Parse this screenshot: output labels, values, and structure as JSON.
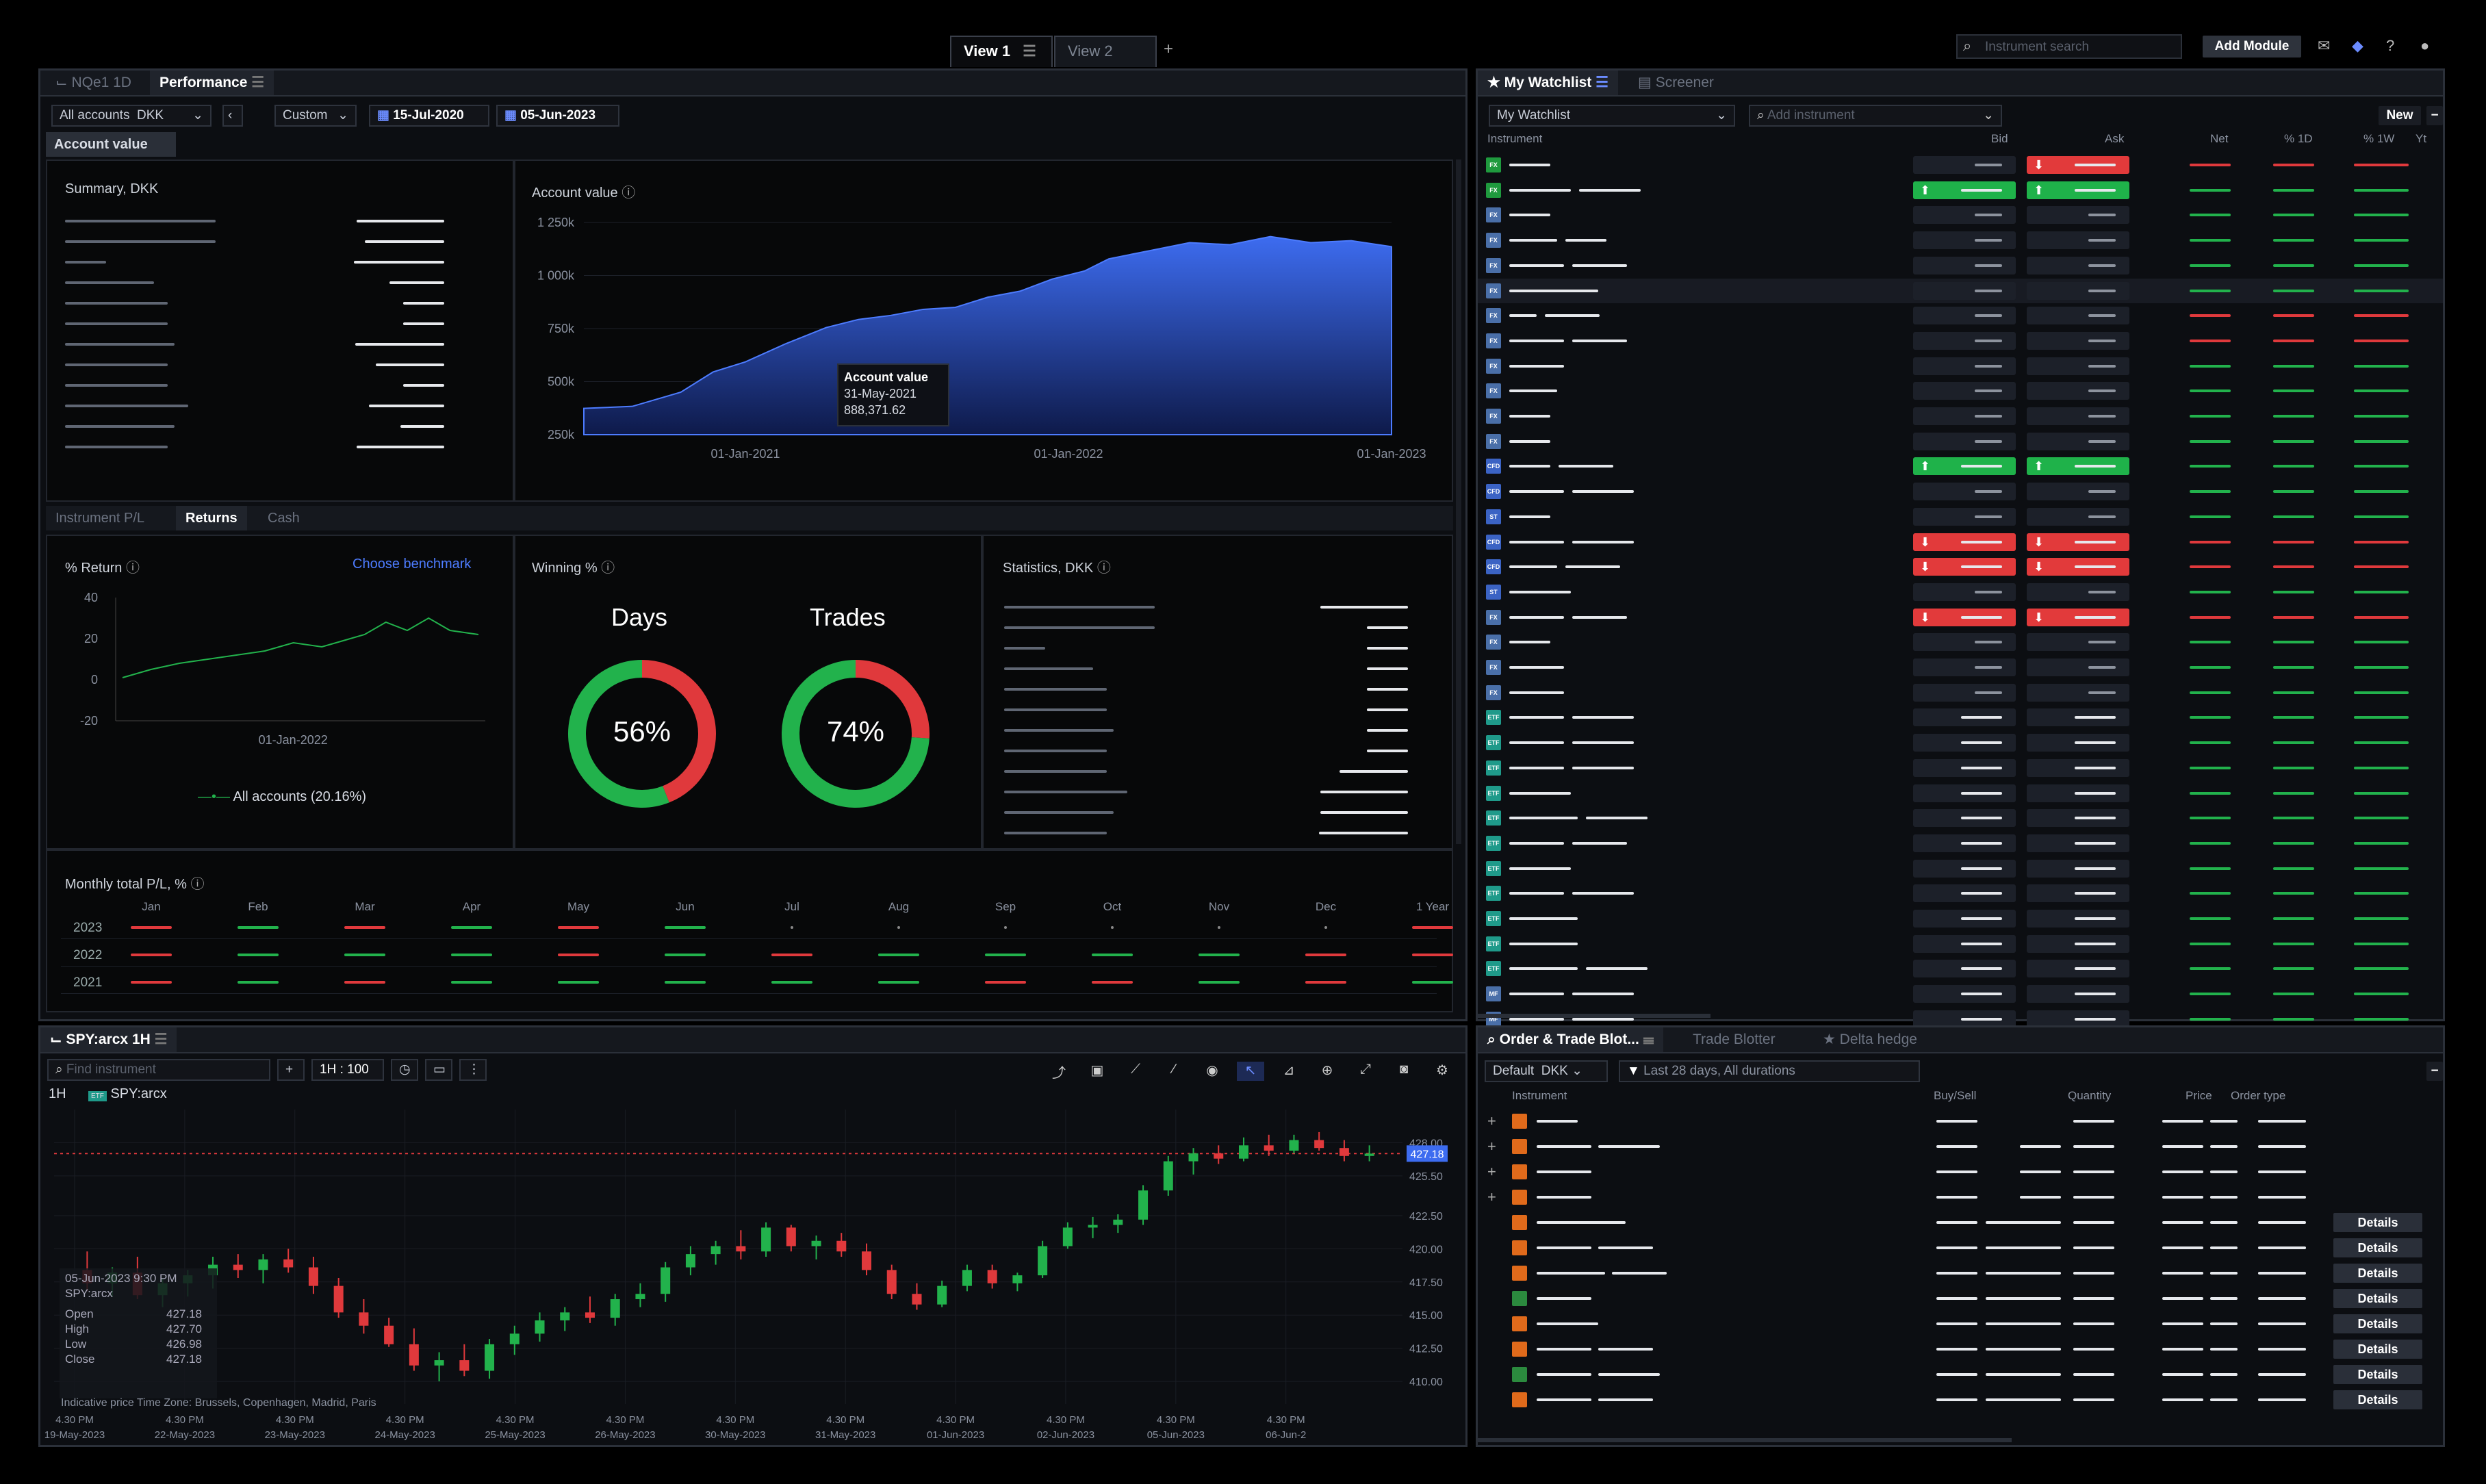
{
  "topbar": {
    "tabs": [
      {
        "label": "View 1"
      },
      {
        "label": "View 2"
      }
    ],
    "add_tab": "+",
    "search_placeholder": "Instrument search",
    "add_module": "Add Module"
  },
  "performance": {
    "tabs": [
      "NQe1 1D",
      "Performance"
    ],
    "account": "All accounts",
    "currency": "DKK",
    "period": "Custom",
    "from_date": "15-Jul-2020",
    "to_date": "05-Jun-2023",
    "section_tab": "Account value",
    "summary_title": "Summary, DKK",
    "chart_title": "Account value",
    "tooltip": {
      "title": "Account value",
      "date": "31-May-2021",
      "value": "888,371.62"
    },
    "sub_tabs": [
      "Instrument P/L",
      "Returns",
      "Cash"
    ],
    "return_title": "% Return",
    "benchmark": "Choose benchmark",
    "return_legend": "All accounts (20.16%)",
    "winning_title": "Winning %",
    "days_label": "Days",
    "days_value": "56%",
    "trades_label": "Trades",
    "trades_value": "74%",
    "stats_title": "Statistics, DKK",
    "monthly_title": "Monthly total P/L, %",
    "months": [
      "Jan",
      "Feb",
      "Mar",
      "Apr",
      "May",
      "Jun",
      "Jul",
      "Aug",
      "Sep",
      "Oct",
      "Nov",
      "Dec",
      "1 Year"
    ],
    "years": [
      "2023",
      "2022",
      "2021"
    ],
    "monthly_colors": [
      [
        "r",
        "g",
        "r",
        "g",
        "r",
        "g",
        "d",
        "d",
        "d",
        "d",
        "d",
        "d",
        "r"
      ],
      [
        "r",
        "g",
        "g",
        "g",
        "r",
        "g",
        "r",
        "g",
        "g",
        "g",
        "g",
        "r",
        "r"
      ],
      [
        "r",
        "g",
        "r",
        "g",
        "g",
        "g",
        "g",
        "g",
        "r",
        "r",
        "g",
        "r",
        "g"
      ]
    ]
  },
  "chart_data": [
    {
      "type": "area",
      "title": "Account value",
      "x_ticks": [
        "01-Jan-2021",
        "01-Jan-2022",
        "01-Jan-2023"
      ],
      "y_ticks": [
        "1 250k",
        "1 000k",
        "750k",
        "500k",
        "250k"
      ],
      "ylim": [
        250000,
        1300000
      ],
      "x": [
        0,
        0.06,
        0.12,
        0.16,
        0.2,
        0.25,
        0.3,
        0.34,
        0.38,
        0.42,
        0.46,
        0.5,
        0.54,
        0.58,
        0.62,
        0.65,
        0.7,
        0.75,
        0.8,
        0.85,
        0.9,
        0.95,
        1.0
      ],
      "values": [
        380000,
        390000,
        460000,
        560000,
        610000,
        700000,
        780000,
        820000,
        840000,
        870000,
        880000,
        930000,
        960000,
        1020000,
        1060000,
        1120000,
        1160000,
        1200000,
        1190000,
        1230000,
        1200000,
        1210000,
        1180000
      ],
      "color": "#3d6cf0"
    },
    {
      "type": "line",
      "title": "% Return",
      "y_ticks": [
        "40",
        "20",
        "0",
        "-20"
      ],
      "x_ticks": [
        "01-Jan-2022"
      ],
      "ylim": [
        -20,
        40
      ],
      "x": [
        0,
        0.08,
        0.16,
        0.24,
        0.32,
        0.4,
        0.48,
        0.56,
        0.62,
        0.68,
        0.74,
        0.8,
        0.86,
        0.92,
        1.0
      ],
      "values": [
        1,
        5,
        8,
        10,
        12,
        14,
        18,
        16,
        19,
        22,
        28,
        24,
        30,
        24,
        22
      ],
      "series": [
        {
          "name": "All accounts (20.16%)"
        }
      ],
      "color": "#22b24c"
    },
    {
      "type": "pie",
      "title": "Days",
      "slices": [
        {
          "label": "win",
          "value": 56,
          "color": "#22b24c"
        },
        {
          "label": "loss",
          "value": 44,
          "color": "#e0393c"
        }
      ]
    },
    {
      "type": "pie",
      "title": "Trades",
      "slices": [
        {
          "label": "win",
          "value": 74,
          "color": "#22b24c"
        },
        {
          "label": "loss",
          "value": 26,
          "color": "#e0393c"
        }
      ]
    },
    {
      "type": "bar",
      "title": "SPY:arcx 1H",
      "ylim": [
        408.3,
        430.5
      ],
      "y_ticks": [
        "428.00",
        "425.50",
        "422.50",
        "420.00",
        "417.50",
        "415.00",
        "412.50",
        "410.00"
      ],
      "current_price": "427.18",
      "candles": [
        [
          418.4,
          419.8,
          416.8,
          417.4
        ],
        [
          417.4,
          418.6,
          416.4,
          418.2
        ],
        [
          418.2,
          419.4,
          416.2,
          416.5
        ],
        [
          416.5,
          417.8,
          415.6,
          417.4
        ],
        [
          417.4,
          418.4,
          416.4,
          418.0
        ],
        [
          418.0,
          419.4,
          417.0,
          418.8
        ],
        [
          418.8,
          419.6,
          417.8,
          418.4
        ],
        [
          418.4,
          419.6,
          417.4,
          419.2
        ],
        [
          419.2,
          420.0,
          418.2,
          418.6
        ],
        [
          418.6,
          419.4,
          416.6,
          417.2
        ],
        [
          417.2,
          417.8,
          414.8,
          415.2
        ],
        [
          415.2,
          416.2,
          413.6,
          414.2
        ],
        [
          414.2,
          414.8,
          412.6,
          412.8
        ],
        [
          412.8,
          414.0,
          410.8,
          411.2
        ],
        [
          411.2,
          412.2,
          410.0,
          411.6
        ],
        [
          411.6,
          412.8,
          410.4,
          410.8
        ],
        [
          410.8,
          413.2,
          410.2,
          412.8
        ],
        [
          412.8,
          414.2,
          412.0,
          413.6
        ],
        [
          413.6,
          415.2,
          413.0,
          414.6
        ],
        [
          414.6,
          415.6,
          413.8,
          415.2
        ],
        [
          415.2,
          416.4,
          414.4,
          414.8
        ],
        [
          414.8,
          416.6,
          414.2,
          416.2
        ],
        [
          416.2,
          417.4,
          415.6,
          416.6
        ],
        [
          416.6,
          419.0,
          416.0,
          418.6
        ],
        [
          418.6,
          420.2,
          418.0,
          419.6
        ],
        [
          419.6,
          420.6,
          418.8,
          420.2
        ],
        [
          420.2,
          421.4,
          419.2,
          419.8
        ],
        [
          419.8,
          422.0,
          419.4,
          421.6
        ],
        [
          421.6,
          421.8,
          419.8,
          420.2
        ],
        [
          420.2,
          421.0,
          419.2,
          420.6
        ],
        [
          420.6,
          421.2,
          419.4,
          419.8
        ],
        [
          419.8,
          420.4,
          418.0,
          418.4
        ],
        [
          418.4,
          418.8,
          416.2,
          416.6
        ],
        [
          416.6,
          417.4,
          415.4,
          415.8
        ],
        [
          415.8,
          417.6,
          415.6,
          417.2
        ],
        [
          417.2,
          418.8,
          416.8,
          418.4
        ],
        [
          418.4,
          418.8,
          417.0,
          417.4
        ],
        [
          417.4,
          418.2,
          416.8,
          418.0
        ],
        [
          418.0,
          420.6,
          417.8,
          420.2
        ],
        [
          420.2,
          422.0,
          420.0,
          421.6
        ],
        [
          421.6,
          422.4,
          420.8,
          421.8
        ],
        [
          421.8,
          422.6,
          421.2,
          422.2
        ],
        [
          422.2,
          424.8,
          421.8,
          424.4
        ],
        [
          424.4,
          427.0,
          424.0,
          426.6
        ],
        [
          426.6,
          427.6,
          425.6,
          427.2
        ],
        [
          427.2,
          427.8,
          426.4,
          426.8
        ],
        [
          426.8,
          428.4,
          426.6,
          427.8
        ],
        [
          427.8,
          428.6,
          427.0,
          427.4
        ],
        [
          427.4,
          428.6,
          427.2,
          428.2
        ],
        [
          428.2,
          428.8,
          427.4,
          427.6
        ],
        [
          427.6,
          428.2,
          426.6,
          427.0
        ],
        [
          427.0,
          427.8,
          426.6,
          427.18
        ]
      ],
      "time_labels": [
        "4.30 PM",
        "4.30 PM",
        "4.30 PM",
        "4.30 PM",
        "4.30 PM",
        "4.30 PM",
        "4.30 PM",
        "4.30 PM",
        "4.30 PM",
        "4.30 PM",
        "4.30 PM",
        "4.30 PM"
      ],
      "date_labels": [
        "19-May-2023",
        "22-May-2023",
        "23-May-2023",
        "24-May-2023",
        "25-May-2023",
        "26-May-2023",
        "30-May-2023",
        "31-May-2023",
        "01-Jun-2023",
        "02-Jun-2023",
        "05-Jun-2023",
        "06-Jun-2"
      ]
    }
  ],
  "watchlist": {
    "tabs": [
      "My Watchlist",
      "Screener"
    ],
    "list_name": "My Watchlist",
    "add_placeholder": "Add instrument",
    "new_btn": "New",
    "columns": [
      "Instrument",
      "Bid",
      "Ask",
      "Net",
      "% 1D",
      "% 1W",
      "Yt"
    ],
    "rows": [
      {
        "t": "FX",
        "c": "#1f9a3e",
        "bid": "d",
        "ask": "rf",
        "n": "r",
        "p": "r",
        "w": "r"
      },
      {
        "t": "FX",
        "c": "#1f9a3e",
        "bid": "gf",
        "ask": "gf",
        "n": "g",
        "p": "g",
        "w": "g"
      },
      {
        "t": "FX",
        "c": "#4a6fa8",
        "bid": "d",
        "ask": "d",
        "n": "g",
        "p": "g",
        "w": "g"
      },
      {
        "t": "FX",
        "c": "#4a6fa8",
        "bid": "d",
        "ask": "d",
        "n": "g",
        "p": "g",
        "w": "g"
      },
      {
        "t": "FX",
        "c": "#4a6fa8",
        "bid": "d",
        "ask": "d",
        "n": "g",
        "p": "g",
        "w": "g"
      },
      {
        "t": "FX",
        "c": "#4a6fa8",
        "bid": "d",
        "ask": "d",
        "n": "g",
        "p": "g",
        "w": "g"
      },
      {
        "t": "FX",
        "c": "#4a6fa8",
        "bid": "d",
        "ask": "d",
        "n": "r",
        "p": "r",
        "w": "r"
      },
      {
        "t": "FX",
        "c": "#4a6fa8",
        "bid": "d",
        "ask": "d",
        "n": "r",
        "p": "r",
        "w": "r"
      },
      {
        "t": "FX",
        "c": "#4a6fa8",
        "bid": "d",
        "ask": "d",
        "n": "g",
        "p": "g",
        "w": "g"
      },
      {
        "t": "FX",
        "c": "#4a6fa8",
        "bid": "d",
        "ask": "d",
        "n": "g",
        "p": "g",
        "w": "g"
      },
      {
        "t": "FX",
        "c": "#4a6fa8",
        "bid": "d",
        "ask": "d",
        "n": "g",
        "p": "g",
        "w": "g"
      },
      {
        "t": "FX",
        "c": "#4a6fa8",
        "bid": "d",
        "ask": "d",
        "n": "g",
        "p": "g",
        "w": "g"
      },
      {
        "t": "CFD",
        "c": "#3b63c4",
        "bid": "gf",
        "ask": "gf",
        "n": "g",
        "p": "g",
        "w": "g"
      },
      {
        "t": "CFD",
        "c": "#3b63c4",
        "bid": "d",
        "ask": "d",
        "n": "g",
        "p": "g",
        "w": "g"
      },
      {
        "t": "ST",
        "c": "#3b63c4",
        "bid": "d",
        "ask": "d",
        "n": "g",
        "p": "g",
        "w": "g"
      },
      {
        "t": "CFD",
        "c": "#3b63c4",
        "bid": "rf",
        "ask": "rf",
        "n": "r",
        "p": "r",
        "w": "r"
      },
      {
        "t": "CFD",
        "c": "#3b63c4",
        "bid": "rf",
        "ask": "rf",
        "n": "r",
        "p": "r",
        "w": "r"
      },
      {
        "t": "ST",
        "c": "#3b63c4",
        "bid": "d",
        "ask": "d",
        "n": "g",
        "p": "g",
        "w": "g"
      },
      {
        "t": "FX",
        "c": "#4a6fa8",
        "bid": "rf",
        "ask": "rf",
        "n": "r",
        "p": "r",
        "w": "r"
      },
      {
        "t": "FX",
        "c": "#4a6fa8",
        "bid": "d",
        "ask": "d",
        "n": "g",
        "p": "g",
        "w": "g"
      },
      {
        "t": "FX",
        "c": "#4a6fa8",
        "bid": "d",
        "ask": "d",
        "n": "g",
        "p": "g",
        "w": "g"
      },
      {
        "t": "FX",
        "c": "#4a6fa8",
        "bid": "d",
        "ask": "d",
        "n": "g",
        "p": "g",
        "w": "g"
      },
      {
        "t": "ETF",
        "c": "#1f9a8a",
        "bid": "w",
        "ask": "w",
        "n": "g",
        "p": "g",
        "w": "g"
      },
      {
        "t": "ETF",
        "c": "#1f9a8a",
        "bid": "w",
        "ask": "w",
        "n": "g",
        "p": "g",
        "w": "g"
      },
      {
        "t": "ETF",
        "c": "#1f9a8a",
        "bid": "w",
        "ask": "w",
        "n": "g",
        "p": "g",
        "w": "g"
      },
      {
        "t": "ETF",
        "c": "#1f9a8a",
        "bid": "w",
        "ask": "w",
        "n": "g",
        "p": "g",
        "w": "g"
      },
      {
        "t": "ETF",
        "c": "#1f9a8a",
        "bid": "w",
        "ask": "w",
        "n": "g",
        "p": "g",
        "w": "g"
      },
      {
        "t": "ETF",
        "c": "#1f9a8a",
        "bid": "w",
        "ask": "w",
        "n": "g",
        "p": "g",
        "w": "g"
      },
      {
        "t": "ETF",
        "c": "#1f9a8a",
        "bid": "w",
        "ask": "w",
        "n": "g",
        "p": "g",
        "w": "g"
      },
      {
        "t": "ETF",
        "c": "#1f9a8a",
        "bid": "w",
        "ask": "w",
        "n": "g",
        "p": "g",
        "w": "g"
      },
      {
        "t": "ETF",
        "c": "#1f9a8a",
        "bid": "w",
        "ask": "w",
        "n": "g",
        "p": "g",
        "w": "g"
      },
      {
        "t": "ETF",
        "c": "#1f9a8a",
        "bid": "w",
        "ask": "w",
        "n": "g",
        "p": "g",
        "w": "g"
      },
      {
        "t": "ETF",
        "c": "#1f9a8a",
        "bid": "w",
        "ask": "w",
        "n": "g",
        "p": "g",
        "w": "g"
      },
      {
        "t": "MF",
        "c": "#4a6fa8",
        "bid": "w",
        "ask": "w",
        "n": "g",
        "p": "g",
        "w": "g"
      },
      {
        "t": "MF",
        "c": "#4a6fa8",
        "bid": "w",
        "ask": "w",
        "n": "g",
        "p": "g",
        "w": "g"
      }
    ]
  },
  "chart_panel": {
    "title": "SPY:arcx 1H",
    "find_placeholder": "Find instrument",
    "interval": "1H : 100",
    "timeframe": "1H",
    "symbol": "SPY:arcx",
    "ohlc_header": "05-Jun-2023 9:30 PM",
    "ohlc_symbol": "SPY:arcx",
    "ohlc": [
      [
        "Open",
        "427.18"
      ],
      [
        "High",
        "427.70"
      ],
      [
        "Low",
        "426.98"
      ],
      [
        "Close",
        "427.18"
      ]
    ],
    "footer": "Indicative price    Time Zone: Brussels, Copenhagen, Madrid, Paris"
  },
  "orders": {
    "tabs": [
      "Order & Trade Blot...",
      "Trade Blotter",
      "Delta hedge"
    ],
    "view": "Default",
    "currency": "DKK",
    "filter": "Last 28 days, All durations",
    "columns": [
      "Instrument",
      "Buy/Sell",
      "Quantity",
      "Price",
      "Order type"
    ],
    "details_label": "Details",
    "rows": [
      {
        "plus": true,
        "details": false
      },
      {
        "plus": true,
        "details": false
      },
      {
        "plus": true,
        "details": false
      },
      {
        "plus": true,
        "details": false
      },
      {
        "plus": false,
        "details": true
      },
      {
        "plus": false,
        "details": true
      },
      {
        "plus": false,
        "details": true
      },
      {
        "plus": false,
        "details": true
      },
      {
        "plus": false,
        "details": true
      },
      {
        "plus": false,
        "details": true
      },
      {
        "plus": false,
        "details": true
      },
      {
        "plus": false,
        "details": true
      }
    ]
  }
}
